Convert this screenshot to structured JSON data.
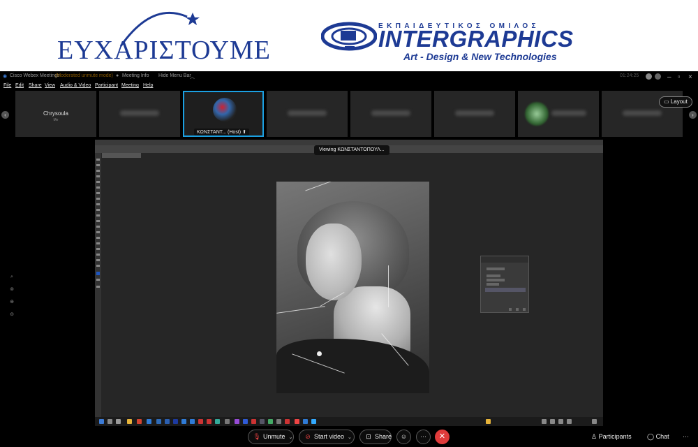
{
  "banner": {
    "left_logo_text": "ΕΥΧΑΡΙΣΤΟΥΜΕ",
    "right_logo": {
      "top_text": "ΕΚΠΑΙΔΕΥΤΙΚΟΣ ΟΜΙΛΟΣ",
      "main_text": "INTERGRAPHICS",
      "tagline": "Art - Design & New Technologies"
    },
    "brand_color": "#1d3a94"
  },
  "titlebar": {
    "app_name": "Cisco Webex Meetings",
    "mode": "(Moderated unmute mode)",
    "meeting_info": "Meeting Info",
    "hide_menu": "Hide Menu Bar",
    "time": "01:24:25"
  },
  "menu": [
    "File",
    "Edit",
    "Share",
    "View",
    "Audio & Video",
    "Participant",
    "Meeting",
    "Help"
  ],
  "participants": {
    "me": {
      "name": "Chrysoula",
      "sub": "Me"
    },
    "host": {
      "label": "ΚΩΝΣΤΑΝΤ... (Host)"
    },
    "layout_label": "Layout"
  },
  "share": {
    "viewing_label": "Viewing ΚΩΝΣΤΑΝΤΟΠΟΥΛ..."
  },
  "controls": {
    "unmute": "Unmute",
    "start_video": "Start video",
    "share": "Share",
    "participants": "Participants",
    "chat": "Chat",
    "more": "···",
    "accent_red": "#e03b3b"
  }
}
